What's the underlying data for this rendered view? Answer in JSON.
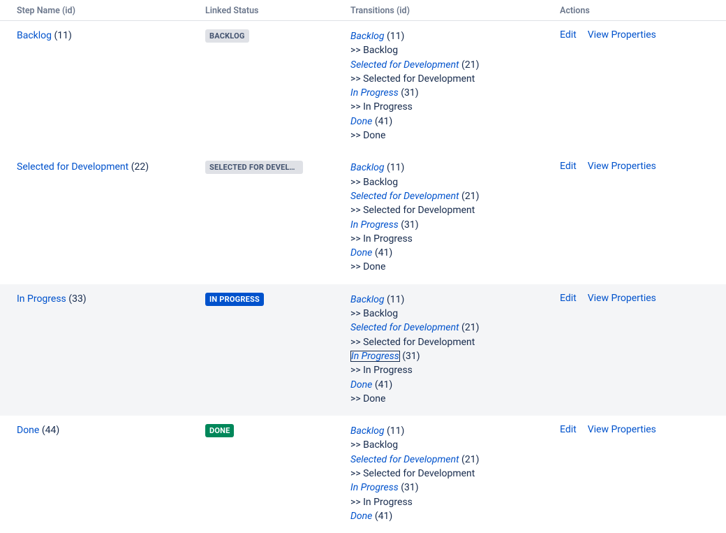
{
  "columns": {
    "step": "Step Name (id)",
    "status": "Linked Status",
    "transitions": "Transitions (id)",
    "actions": "Actions"
  },
  "actions": {
    "edit": "Edit",
    "viewProps": "View Properties"
  },
  "lozenges": {
    "backlog": {
      "text": "BACKLOG",
      "cls": "loz-default"
    },
    "selected": {
      "text": "SELECTED FOR DEVELOPMENT",
      "cls": "loz-default"
    },
    "inprogress": {
      "text": "IN PROGRESS",
      "cls": "loz-inprogress"
    },
    "done": {
      "text": "DONE",
      "cls": "loz-success"
    }
  },
  "rows": [
    {
      "highlight": false,
      "step": {
        "name": "Backlog",
        "id": "(11)"
      },
      "statusKey": "backlog",
      "transitions": [
        {
          "name": "Backlog",
          "id": "(11)",
          "target": ">> Backlog",
          "focused": false
        },
        {
          "name": "Selected for Development",
          "id": "(21)",
          "target": ">> Selected for Development",
          "focused": false
        },
        {
          "name": "In Progress",
          "id": "(31)",
          "target": ">> In Progress",
          "focused": false
        },
        {
          "name": "Done",
          "id": "(41)",
          "target": ">> Done",
          "focused": false
        }
      ]
    },
    {
      "highlight": false,
      "step": {
        "name": "Selected for Development",
        "id": "(22)"
      },
      "statusKey": "selected",
      "transitions": [
        {
          "name": "Backlog",
          "id": "(11)",
          "target": ">> Backlog",
          "focused": false
        },
        {
          "name": "Selected for Development",
          "id": "(21)",
          "target": ">> Selected for Development",
          "focused": false
        },
        {
          "name": "In Progress",
          "id": "(31)",
          "target": ">> In Progress",
          "focused": false
        },
        {
          "name": "Done",
          "id": "(41)",
          "target": ">> Done",
          "focused": false
        }
      ]
    },
    {
      "highlight": true,
      "step": {
        "name": "In Progress",
        "id": "(33)"
      },
      "statusKey": "inprogress",
      "transitions": [
        {
          "name": "Backlog",
          "id": "(11)",
          "target": ">> Backlog",
          "focused": false
        },
        {
          "name": "Selected for Development",
          "id": "(21)",
          "target": ">> Selected for Development",
          "focused": false
        },
        {
          "name": "In Progress",
          "id": "(31)",
          "target": ">> In Progress",
          "focused": true
        },
        {
          "name": "Done",
          "id": "(41)",
          "target": ">> Done",
          "focused": false
        }
      ]
    },
    {
      "highlight": false,
      "step": {
        "name": "Done",
        "id": "(44)"
      },
      "statusKey": "done",
      "transitions": [
        {
          "name": "Backlog",
          "id": "(11)",
          "target": ">> Backlog",
          "focused": false
        },
        {
          "name": "Selected for Development",
          "id": "(21)",
          "target": ">> Selected for Development",
          "focused": false
        },
        {
          "name": "In Progress",
          "id": "(31)",
          "target": ">> In Progress",
          "focused": false
        },
        {
          "name": "Done",
          "id": "(41)",
          "target": "",
          "focused": false
        }
      ]
    }
  ]
}
